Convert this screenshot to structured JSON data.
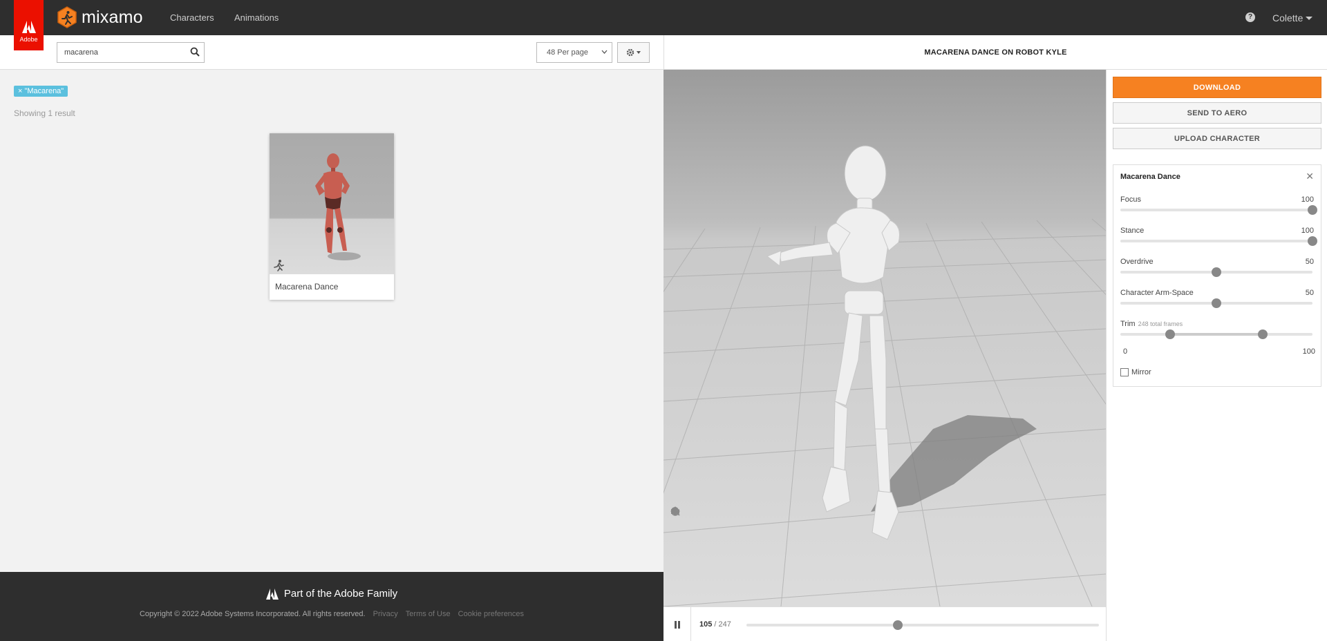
{
  "topnav": {
    "adobe_label": "Adobe",
    "brand": "mixamo",
    "links": [
      "Characters",
      "Animations"
    ],
    "help": "?",
    "user": "Colette"
  },
  "search": {
    "value": "macarena",
    "placeholder": ""
  },
  "per_page": "48 Per page",
  "results": {
    "filter_tag": "× \"Macarena\"",
    "count_text": "Showing 1 result",
    "cards": [
      {
        "title": "Macarena Dance"
      }
    ]
  },
  "footer": {
    "family": "Part of the Adobe Family",
    "copyright": "Copyright © 2022 Adobe Systems Incorporated. All rights reserved.",
    "links": [
      "Privacy",
      "Terms of Use",
      "Cookie preferences"
    ]
  },
  "preview": {
    "title": "MACARENA DANCE ON ROBOT KYLE",
    "current_frame": "105",
    "total_frames": "/ 247",
    "progress": 0.43
  },
  "actions": {
    "download": "DOWNLOAD",
    "send_to_aero": "SEND TO AERO",
    "upload_character": "UPLOAD CHARACTER"
  },
  "settings": {
    "title": "Macarena Dance",
    "close": "✕",
    "params": [
      {
        "label": "Focus",
        "value": "100",
        "fraction": 1.0
      },
      {
        "label": "Stance",
        "value": "100",
        "fraction": 1.0
      },
      {
        "label": "Overdrive",
        "value": "50",
        "fraction": 0.5
      },
      {
        "label": "Character Arm-Space",
        "value": "50",
        "fraction": 0.5
      }
    ],
    "trim": {
      "label": "Trim",
      "sub": "248 total frames",
      "start": 0.26,
      "end": 0.74,
      "min_label": "0",
      "max_label": "100"
    },
    "mirror_label": "Mirror"
  },
  "colors": {
    "accent": "#f68121",
    "adobe_red": "#eb1000",
    "tag": "#5bc0de",
    "nav": "#2e2e2e"
  }
}
